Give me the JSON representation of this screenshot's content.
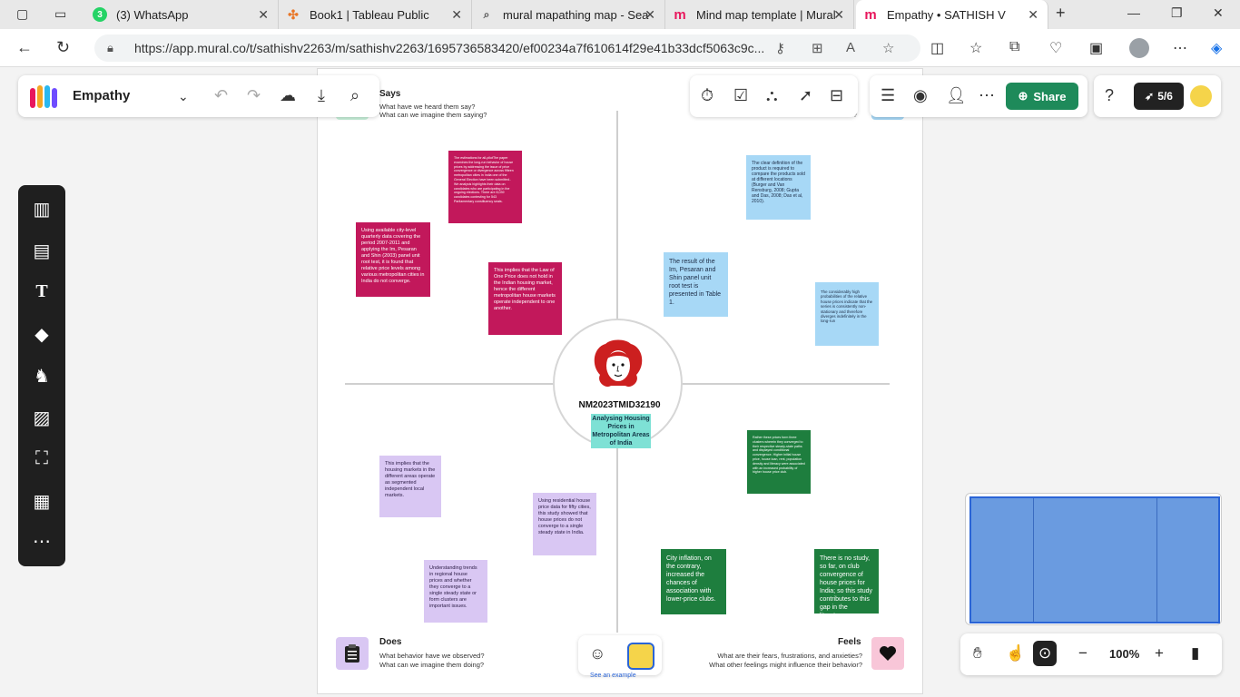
{
  "browser": {
    "tabs": [
      {
        "title": "(3) WhatsApp",
        "icon": "whatsapp-icon",
        "color": "#25d366",
        "badge": "3"
      },
      {
        "title": "Book1 | Tableau Public",
        "icon": "tableau-icon",
        "color": "#e97627"
      },
      {
        "title": "mural mapathing map - Sea",
        "icon": "search-icon",
        "color": "#555555"
      },
      {
        "title": "Mind map template | Mural",
        "icon": "mural-icon",
        "color": "#e8175d"
      },
      {
        "title": "Empathy • SATHISH V",
        "icon": "mural-icon",
        "color": "#e8175d"
      }
    ],
    "url": "https://app.mural.co/t/sathishv2263/m/sathishv2263/1695736583420/ef00234a7f610614f29e41b33dcf5063c9c..."
  },
  "app": {
    "board_name": "Empathy",
    "share_label": "Share",
    "progress_label": "5/6",
    "zoom_level": "100%",
    "see_example": "See an example"
  },
  "center": {
    "id": "NM2023TMID32190",
    "title": "Analysing Housing Prices in Metropolitan Areas of India"
  },
  "quadrants": {
    "says": {
      "label": "Says",
      "sub1": "What have we heard them say?",
      "sub2": "What can we imagine them saying?"
    },
    "thinks": {
      "sub_partial": "?"
    },
    "does": {
      "label": "Does",
      "sub1": "What behavior have we observed?",
      "sub2": "What can we imagine them doing?"
    },
    "feels": {
      "label": "Feels",
      "sub1": "What are their fears, frustrations, and anxieties?",
      "sub2": "What other feelings might influence their behavior?"
    }
  },
  "notes": {
    "mag1": "The estimations for all-pilotThe paper examines the long-run behavior of house prices by addressing the issue of price convergence or divergence across fifteen metropolitan cities in India one of the General Election have been submitted.. We analysis highlights their data on candidates who are participating in the ongoing elections. There are 8,039 candidates contesting for 543 Parliamentary constituency seats.",
    "mag2": "Using available city-level quarterly data covering the period 2007-2011 and applying the Im, Pesaran and Shin (2003) panel unit root test, it is found that relative price levels among various metropolitan cities in India do not converge.",
    "mag3": "This implies that the Law of One Price does not hold in the Indian housing market, hence the different metropolitan house markets operate independent to one another.",
    "blu1": "The clear definition of the product is required to compare the products sold at different locations (Burger and Van Rensburg, 2008; Gupta and Das, 2008; Das et al, 2010).",
    "blu2": "The result of the Im, Pesaran and Shin panel unit root test is presented in Table 1.",
    "blu3": "The considerably high probabilities of the relative house prices indicate that the series is consistently non-stationary and therefore diverges indefinitely in the long-run",
    "pur1": "This implies that the housing markets in the different areas operate as segmented independent local markets.",
    "pur2": "Using residential house price data for fifty cities, this study showed that house prices do not converge to a single steady state in India.",
    "pur3": "Understanding trends in regional house prices and whether they converge to a single steady state or form clusters are important issues.",
    "grn1": "Rather these prices form three clusters wherein they converged to their respective steady-state paths and displayed conditional convergence. Higher initial house price, house loan, rent, population density and literacy were associated with an increased probability of higher house price club.",
    "grn2": "City inflation, on the contrary, increased the chances of association with lower-price clubs.",
    "grn3": "There is no study, so far, on club convergence of house prices for India; so this study contributes to this gap in the literature."
  },
  "colors": {
    "magenta": "#c2185b",
    "blue_note": "#a7d8f6",
    "purple_note": "#d9c7f3",
    "green_note": "#1e7e3e",
    "share": "#1e8a5a",
    "center_tag": "#7ee1d5"
  }
}
